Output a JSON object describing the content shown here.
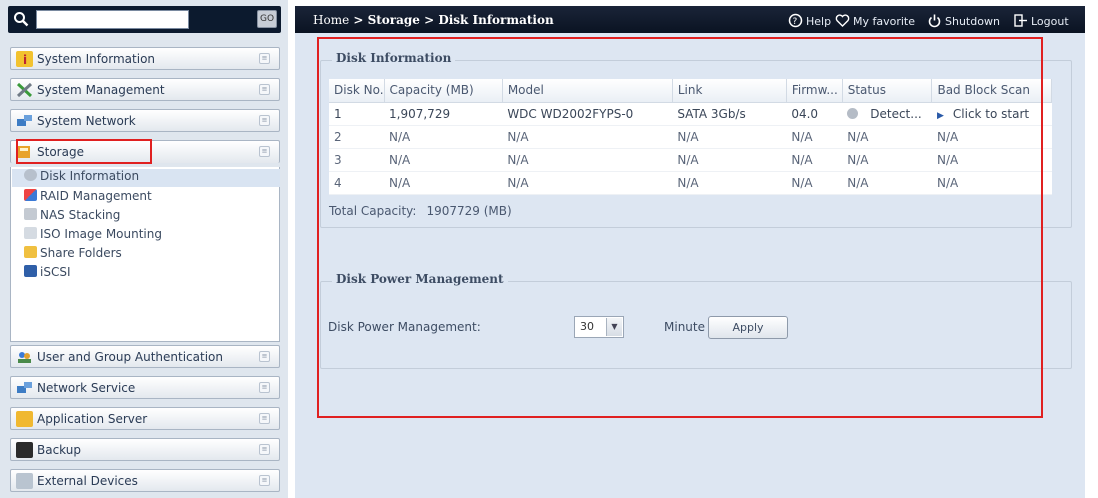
{
  "search": {
    "placeholder": "",
    "go_label": "GO"
  },
  "sidebar": {
    "items_top": [
      {
        "label": "System Information",
        "icon": "info-icon"
      },
      {
        "label": "System Management",
        "icon": "tools-icon"
      },
      {
        "label": "System Network",
        "icon": "network-icon"
      },
      {
        "label": "Storage",
        "icon": "storage-icon"
      }
    ],
    "storage_submenu": [
      {
        "label": "Disk Information",
        "icon": "disk-icon"
      },
      {
        "label": "RAID Management",
        "icon": "raid-icon"
      },
      {
        "label": "NAS Stacking",
        "icon": "stacking-icon"
      },
      {
        "label": "ISO Image Mounting",
        "icon": "iso-icon"
      },
      {
        "label": "Share Folders",
        "icon": "folder-icon"
      },
      {
        "label": "iSCSI",
        "icon": "iscsi-icon"
      }
    ],
    "items_bottom": [
      {
        "label": "User and Group Authentication",
        "icon": "users-icon"
      },
      {
        "label": "Network Service",
        "icon": "network-service-icon"
      },
      {
        "label": "Application Server",
        "icon": "app-server-icon"
      },
      {
        "label": "Backup",
        "icon": "backup-icon"
      },
      {
        "label": "External Devices",
        "icon": "external-devices-icon"
      }
    ]
  },
  "topbar": {
    "breadcrumb_home": "Home",
    "breadcrumb_rest": " > Storage > Disk Information",
    "help": "Help",
    "favorite": "My favorite",
    "shutdown": "Shutdown",
    "logout": "Logout"
  },
  "disk_info": {
    "legend": "Disk Information",
    "columns": [
      "Disk No.",
      "Capacity (MB)",
      "Model",
      "Link",
      "Firmw...",
      "Status",
      "Bad Block Scan"
    ],
    "rows": [
      [
        "1",
        "1,907,729",
        "WDC WD2002FYPS-0",
        "SATA 3Gb/s",
        "04.0",
        "Detect...",
        "Click to start"
      ],
      [
        "2",
        "N/A",
        "N/A",
        "N/A",
        "N/A",
        "N/A",
        "N/A"
      ],
      [
        "3",
        "N/A",
        "N/A",
        "N/A",
        "N/A",
        "N/A",
        "N/A"
      ],
      [
        "4",
        "N/A",
        "N/A",
        "N/A",
        "N/A",
        "N/A",
        "N/A"
      ]
    ],
    "total_label": "Total Capacity:",
    "total_value": "1907729 (MB)"
  },
  "power": {
    "legend": "Disk Power Management",
    "label": "Disk Power Management:",
    "value": "30",
    "unit": "Minute",
    "apply": "Apply"
  },
  "colors": {
    "highlight": "#e02020",
    "topbar": "#0a1322",
    "panel": "#dde6f2"
  }
}
